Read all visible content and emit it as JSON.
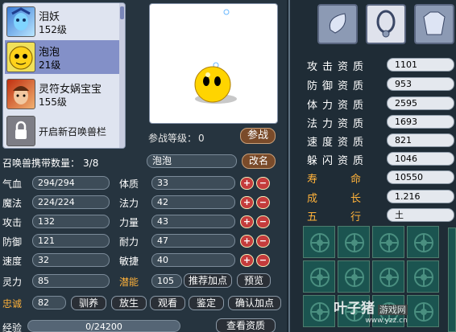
{
  "summon_list": [
    {
      "name": "泪妖",
      "level": "152级"
    },
    {
      "name": "泡泡",
      "level": "21级"
    },
    {
      "name": "灵符女娲宝宝",
      "level": "155级"
    }
  ],
  "unlock_slot_label": "开启新召唤兽栏",
  "battle_level": {
    "label": "参战等级：",
    "value": "0"
  },
  "battle_button": "参战",
  "carry_label": "召唤兽携带数量：",
  "carry_value": "3/8",
  "pet_name": "泡泡",
  "rename_button": "改名",
  "stats_left": [
    {
      "label": "气血",
      "value": "294/294"
    },
    {
      "label": "魔法",
      "value": "224/224"
    },
    {
      "label": "攻击",
      "value": "132"
    },
    {
      "label": "防御",
      "value": "121"
    },
    {
      "label": "速度",
      "value": "32"
    },
    {
      "label": "灵力",
      "value": "85"
    },
    {
      "label": "忠诚",
      "value": "82"
    }
  ],
  "stats_mid": [
    {
      "label": "体质",
      "value": "33"
    },
    {
      "label": "法力",
      "value": "42"
    },
    {
      "label": "力量",
      "value": "43"
    },
    {
      "label": "耐力",
      "value": "47"
    },
    {
      "label": "敏捷",
      "value": "40"
    }
  ],
  "potential": {
    "label": "潜能",
    "value": "105"
  },
  "buttons": {
    "recommend": "推荐加点",
    "preview": "预览",
    "tame": "驯养",
    "release": "放生",
    "view": "观看",
    "appraise": "鉴定",
    "confirm": "确认加点",
    "view_aptitude": "查看资质"
  },
  "exp": {
    "label": "经验",
    "value": "0/24200"
  },
  "aptitudes": [
    {
      "label": "攻击资质",
      "value": "1101"
    },
    {
      "label": "防御资质",
      "value": "953"
    },
    {
      "label": "体力资质",
      "value": "2595"
    },
    {
      "label": "法力资质",
      "value": "1693"
    },
    {
      "label": "速度资质",
      "value": "821"
    },
    {
      "label": "躲闪资质",
      "value": "1046"
    },
    {
      "label": "寿命",
      "value": "10550"
    },
    {
      "label": "成长",
      "value": "1.216"
    },
    {
      "label": "五行",
      "value": "土"
    }
  ],
  "equipment_icons": [
    "feather-equip-icon",
    "collar-equip-icon",
    "armor-equip-icon"
  ],
  "watermark": {
    "brand": "叶子猪",
    "sub": "游戏网",
    "url": "www.yzz.cn"
  },
  "colors": {
    "accent_orange": "#ffb23a",
    "panel": "#26343f",
    "skill_cell": "#1b5450"
  }
}
